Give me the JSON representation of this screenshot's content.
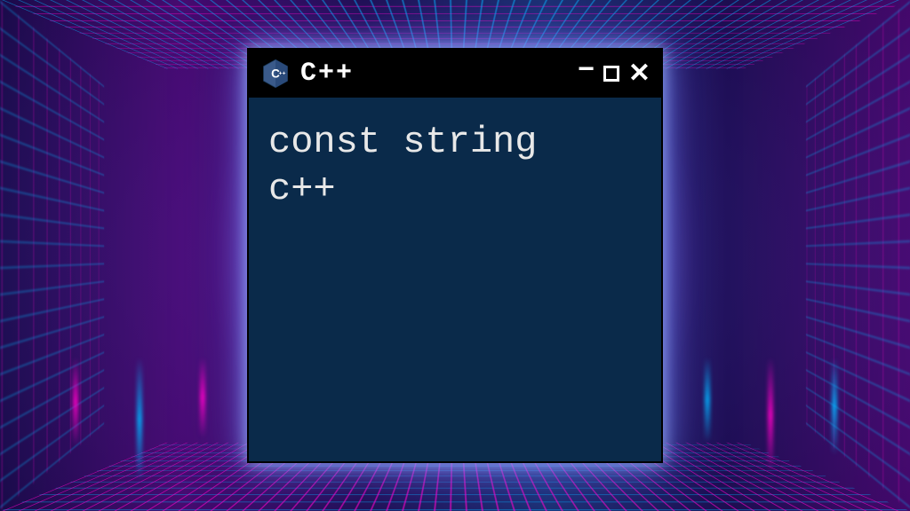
{
  "window": {
    "title": "C++",
    "icon_name": "cpp-icon"
  },
  "content": {
    "line1": "const string",
    "line2": "c++"
  },
  "colors": {
    "window_bg": "#0a2a4a",
    "titlebar_bg": "#000000",
    "text": "#e8e8e8",
    "neon_pink": "#ff00c8",
    "neon_cyan": "#00b4ff"
  }
}
